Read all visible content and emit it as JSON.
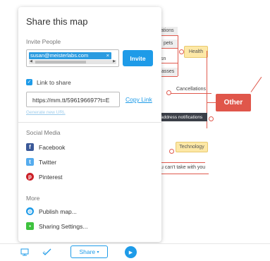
{
  "map": {
    "nodes": {
      "ations": "ations",
      "pets": "pets",
      "sn": "sn",
      "asses": "asses",
      "health": "Health",
      "cancellations": "Cancellations",
      "other": "Other",
      "address_notifications": "address notifications",
      "technology": "Technology",
      "cant_take": "u can't take with you"
    }
  },
  "popup": {
    "title": "Share this map",
    "invite_label": "Invite People",
    "invite_email": "susan@meisterlabs.com",
    "invite_email_remove": "×",
    "invite_button": "Invite",
    "link_to_share_label": "Link to share",
    "share_url": "https://mm.tt/596196697?t=E",
    "copy_link": "Copy Link",
    "generate_new_url": "Generate new URL",
    "social_media_label": "Social Media",
    "social": [
      {
        "label": "Facebook",
        "icon": "facebook-icon",
        "color": "#3b5998",
        "glyph": "f"
      },
      {
        "label": "Twitter",
        "icon": "twitter-icon",
        "color": "#55acee",
        "glyph": "t"
      },
      {
        "label": "Pinterest",
        "icon": "pinterest-icon",
        "color": "#cb2027",
        "glyph": "p"
      }
    ],
    "more_label": "More",
    "more": [
      {
        "label": "Publish map...",
        "icon": "globe-icon",
        "color": "#1e9be8"
      },
      {
        "label": "Sharing Settings...",
        "icon": "lock-icon",
        "color": "#3ec23e"
      }
    ]
  },
  "toolbar": {
    "share_button": "Share",
    "share_caret": "▾",
    "play_glyph": "▶"
  },
  "colors": {
    "accent": "#1e9be8",
    "branch": "#e05a4e"
  }
}
